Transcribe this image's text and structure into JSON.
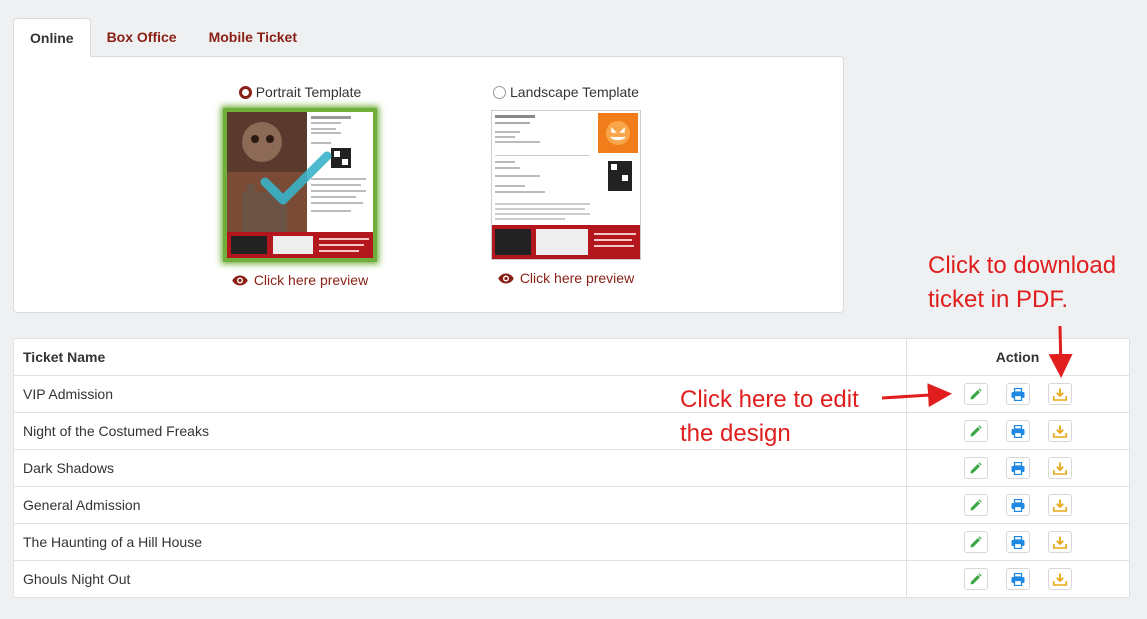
{
  "tabs": [
    {
      "label": "Online",
      "active": true
    },
    {
      "label": "Box Office",
      "active": false
    },
    {
      "label": "Mobile Ticket",
      "active": false
    }
  ],
  "templates": {
    "portrait": {
      "label": "Portrait Template",
      "selected": true,
      "preview_label": "Click here preview"
    },
    "landscape": {
      "label": "Landscape Template",
      "selected": false,
      "preview_label": "Click here preview"
    }
  },
  "table": {
    "headers": {
      "name": "Ticket Name",
      "action": "Action"
    },
    "rows": [
      "VIP Admission",
      "Night of the Costumed Freaks",
      "Dark Shadows",
      "General Admission",
      "The Haunting of a Hill House",
      "Ghouls Night Out"
    ],
    "action_icons": [
      "pencil-icon",
      "print-icon",
      "download-icon"
    ]
  },
  "annotations": {
    "pdf": [
      "Click to download",
      "ticket in PDF."
    ],
    "edit": [
      "Click here to edit",
      "the design"
    ]
  },
  "colors": {
    "accent": "#8a1f15",
    "annotation": "#e01e1e",
    "edit": "#3aa745",
    "print": "#1e88e5",
    "download": "#e6a817",
    "selected_border": "#6fae3a"
  }
}
